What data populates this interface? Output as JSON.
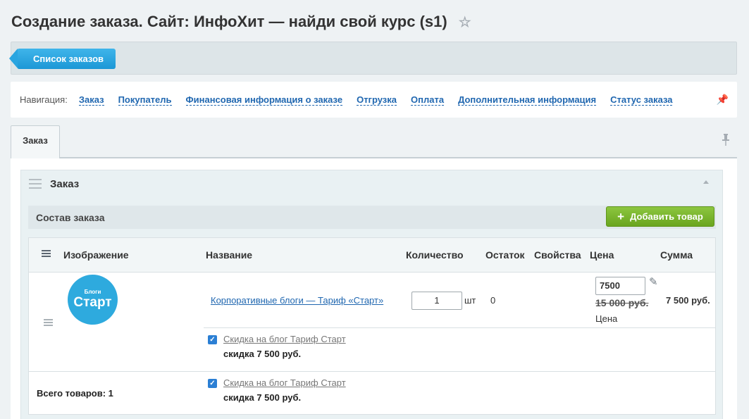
{
  "header": {
    "title": "Создание заказа. Сайт: ИнфоХит — найди свой курс (s1)",
    "star_icon": "star-icon"
  },
  "toolbar": {
    "list_button": "Список заказов"
  },
  "nav": {
    "label": "Навигация:",
    "links": [
      "Заказ",
      "Покупатель",
      "Финансовая информация о заказе",
      "Отгрузка",
      "Оплата",
      "Дополнительная информация",
      "Статус заказа"
    ]
  },
  "tabs": {
    "active": "Заказ"
  },
  "section": {
    "title": "Заказ",
    "subtitle": "Состав заказа",
    "add_button": "Добавить товар"
  },
  "table": {
    "columns": [
      "Изображение",
      "Название",
      "Количество",
      "Остаток",
      "Свойства",
      "Цена",
      "Сумма"
    ],
    "item": {
      "logo_top": "Блоги",
      "logo_main": "Старт",
      "name": "Корпоративные блоги — Тариф «Старт»",
      "quantity": "1",
      "unit": "шт",
      "stock": "0",
      "price": "7500",
      "old_price": "15 000 руб.",
      "price_label": "Цена",
      "sum": "7 500 руб."
    },
    "discounts": [
      {
        "name": "Скидка на блог Тариф Старт",
        "amount": "скидка 7 500 руб.",
        "checked": true
      },
      {
        "name": "Скидка на блог Тариф Старт",
        "amount": "скидка 7 500 руб.",
        "checked": true
      }
    ],
    "total": "Всего товаров: 1"
  },
  "colors": {
    "accent_blue": "#1c98d6",
    "green": "#7ab72f",
    "link": "#2067b0"
  }
}
